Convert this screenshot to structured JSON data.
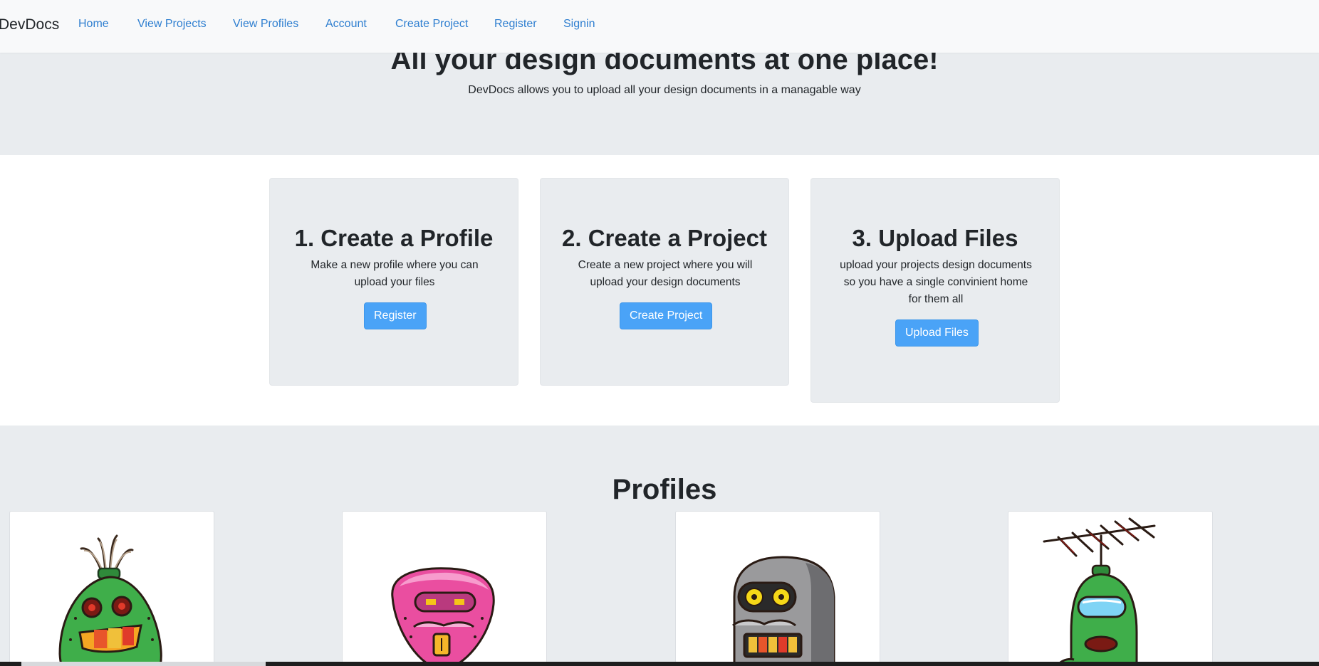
{
  "navbar": {
    "brand": "DevDocs",
    "links": [
      {
        "label": "Home"
      },
      {
        "label": "View Projects"
      },
      {
        "label": "View Profiles"
      },
      {
        "label": "Account"
      },
      {
        "label": "Create Project"
      },
      {
        "label": "Register"
      },
      {
        "label": "Signin"
      }
    ]
  },
  "hero": {
    "title": "All your design documents at one place!",
    "subtitle": "DevDocs allows you to upload all your design documents in a managable way"
  },
  "steps": [
    {
      "title": "1. Create a Profile",
      "text": "Make a new profile where you can upload your files",
      "button": "Register"
    },
    {
      "title": "2. Create a Project",
      "text": "Create a new project where you will upload your design documents",
      "button": "Create Project"
    },
    {
      "title": "3. Upload Files",
      "text": "upload your projects design documents so you have a single convinient home for them all",
      "button": "Upload Files"
    }
  ],
  "profiles": {
    "title": "Profiles",
    "avatars": [
      {
        "icon": "green-robot-avatar"
      },
      {
        "icon": "pink-robot-avatar"
      },
      {
        "icon": "gray-robot-avatar"
      },
      {
        "icon": "antenna-robot-avatar"
      }
    ]
  },
  "colors": {
    "accent": "#4aa3f7",
    "link": "#2f7fd0",
    "panel": "#e9ecef",
    "navbar": "#f8f9fa"
  }
}
